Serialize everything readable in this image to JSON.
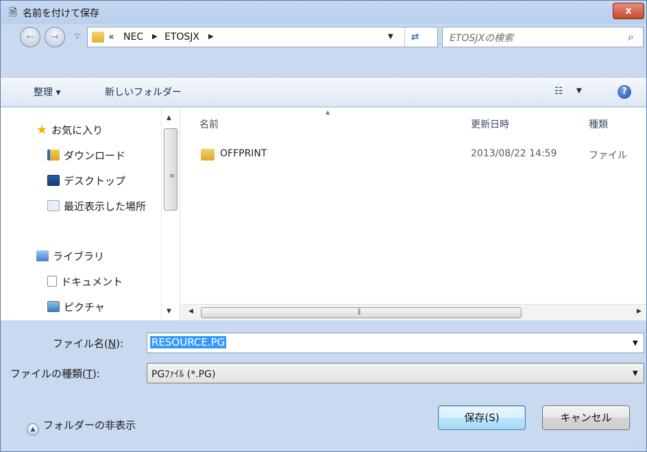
{
  "window": {
    "title": "名前を付けて保存",
    "close_label": "x"
  },
  "address": {
    "segments": [
      "«",
      "NEC",
      "ETOSJX"
    ],
    "search_placeholder": "ETOSJXの検索"
  },
  "toolbar": {
    "organize": "整理 ▾",
    "new_folder": "新しいフォルダー"
  },
  "nav": {
    "favorites": "お気に入り",
    "items_fav": [
      "ダウンロード",
      "デスクトップ",
      "最近表示した場所"
    ],
    "libraries": "ライブラリ",
    "items_lib": [
      "ドキュメント",
      "ピクチャ"
    ]
  },
  "columns": {
    "name": "名前",
    "date": "更新日時",
    "type": "種類"
  },
  "files": [
    {
      "name": "OFFPRINT",
      "date": "2013/08/22 14:59",
      "type": "ファイル"
    }
  ],
  "form": {
    "filename_label_prefix": "ファイル名(",
    "filename_label_key": "N",
    "filename_label_suffix": "):",
    "filename_value": "RESOURCE.PG",
    "filetype_label_prefix": "ファイルの種類(",
    "filetype_label_key": "T",
    "filetype_label_suffix": "):",
    "filetype_value": "PGﾌｧｲﾙ (*.PG)",
    "hide_folders": "フォルダーの非表示",
    "save": "保存(S)",
    "cancel": "キャンセル"
  },
  "icons": [
    "window-icon",
    "back-icon",
    "forward-icon",
    "folder-icon",
    "refresh-icon",
    "search-icon",
    "view-icon",
    "help-icon",
    "star-icon",
    "download-icon",
    "desktop-icon",
    "recent-icon",
    "library-icon",
    "document-icon",
    "picture-icon",
    "chevron-up-icon"
  ],
  "colors": {
    "frame": "#c9daf0",
    "selection": "#3399ff",
    "close": "#c74a2e"
  }
}
